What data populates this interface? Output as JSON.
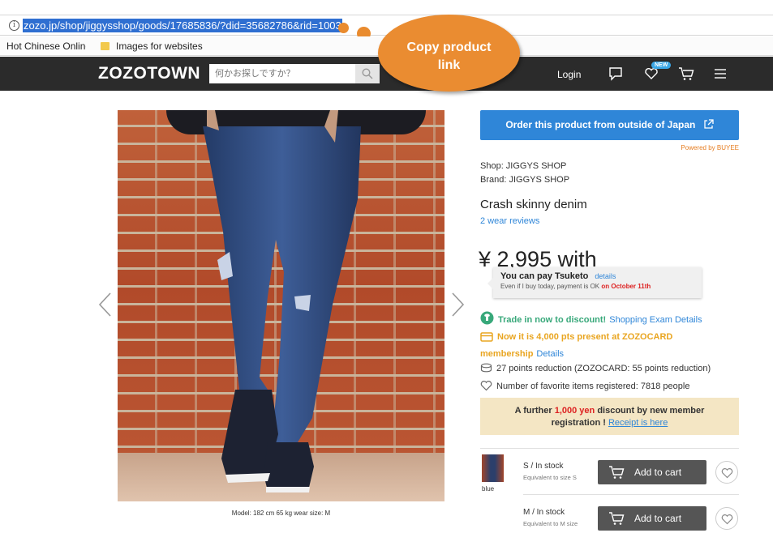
{
  "browser": {
    "url": "zozo.jp/shop/jiggysshop/goods/17685836/?did=35682786&rid=1003",
    "bookmarks": [
      "Hot Chinese Online S",
      "Images for websites"
    ]
  },
  "callout": {
    "text_line1": "Copy product",
    "text_line2": "link",
    "color": "#ea8c31"
  },
  "header": {
    "logo": "ZOZOTOWN",
    "search_placeholder": "何かお探しですか？",
    "login": "Login",
    "new_badge": "NEW"
  },
  "product": {
    "image_caption": "Model: 182 cm 65 kg wear size: M",
    "order_button": "Order this product from outside of Japan",
    "powered_by": "Powered by BUYEE",
    "shop": "Shop: JIGGYS SHOP",
    "brand": "Brand: JIGGYS SHOP",
    "title": "Crash skinny denim",
    "reviews": "2 wear reviews",
    "price": "¥ 2,995 with",
    "tooltip": {
      "title": "You can pay Tsuketo",
      "details": "details",
      "sub": "Even if I buy today, payment is OK",
      "date": "on October 11th"
    },
    "trade": {
      "text": "Trade in now to discount!",
      "link": "Shopping Exam Details"
    },
    "zozocard": {
      "text": "Now it is 4,000 pts present at ZOZOCARD membership",
      "link": "Details"
    },
    "points": "27 points reduction (ZOZOCARD: 55 points reduction)",
    "favorites": "Number of favorite items registered: 7818 people",
    "promo": {
      "part1": "A further ",
      "amount": "1,000 yen",
      "part2": " discount by new member",
      "part3": "registration ! ",
      "link": "Receipt is here"
    },
    "color_label": "blue",
    "sizes": [
      {
        "label": "S / In  stock",
        "sub": "Equivalent to size S",
        "button": "Add to cart"
      },
      {
        "label": "M / In  stock",
        "sub": "Equivalent to M size",
        "button": "Add to cart"
      }
    ]
  },
  "colors": {
    "accent_blue": "#2f86d8",
    "header_bg": "#2b2b2b",
    "orange": "#ea8c31",
    "green": "#38a87a"
  }
}
